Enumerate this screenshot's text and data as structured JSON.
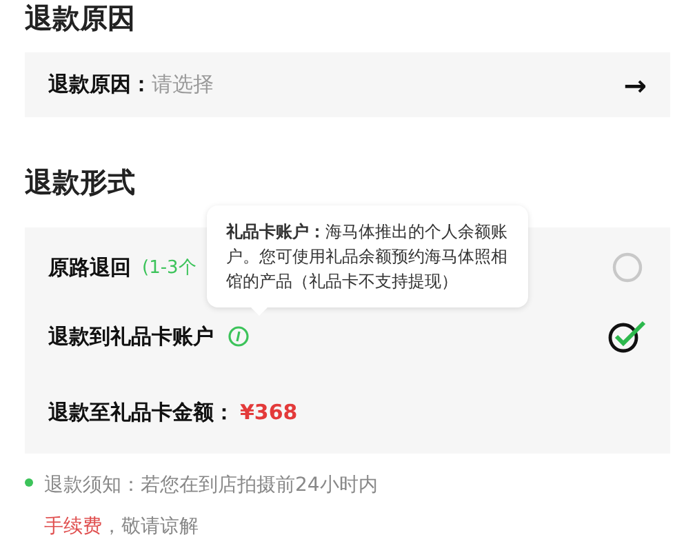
{
  "reason_section": {
    "title": "退款原因",
    "label": "退款原因：",
    "placeholder": "请选择",
    "arrow": "→"
  },
  "method_section": {
    "title": "退款形式",
    "options": [
      {
        "label": "原路退回",
        "note": "(1-3个",
        "selected": false,
        "info": false
      },
      {
        "label": "退款到礼品卡账户",
        "selected": true,
        "info": true
      }
    ],
    "amount_label": "退款至礼品卡金额：",
    "amount": "¥368",
    "tooltip": "**礼品卡账户：**海马体推出的个人余额账户。您可使用礼品余额预约海马体照相馆的产品（礼品卡不支持提现）"
  },
  "notice": {
    "lines": [
      "退款须知：若您在到店拍摄前24小时内",
      "**手续费**，敬请谅解"
    ]
  }
}
